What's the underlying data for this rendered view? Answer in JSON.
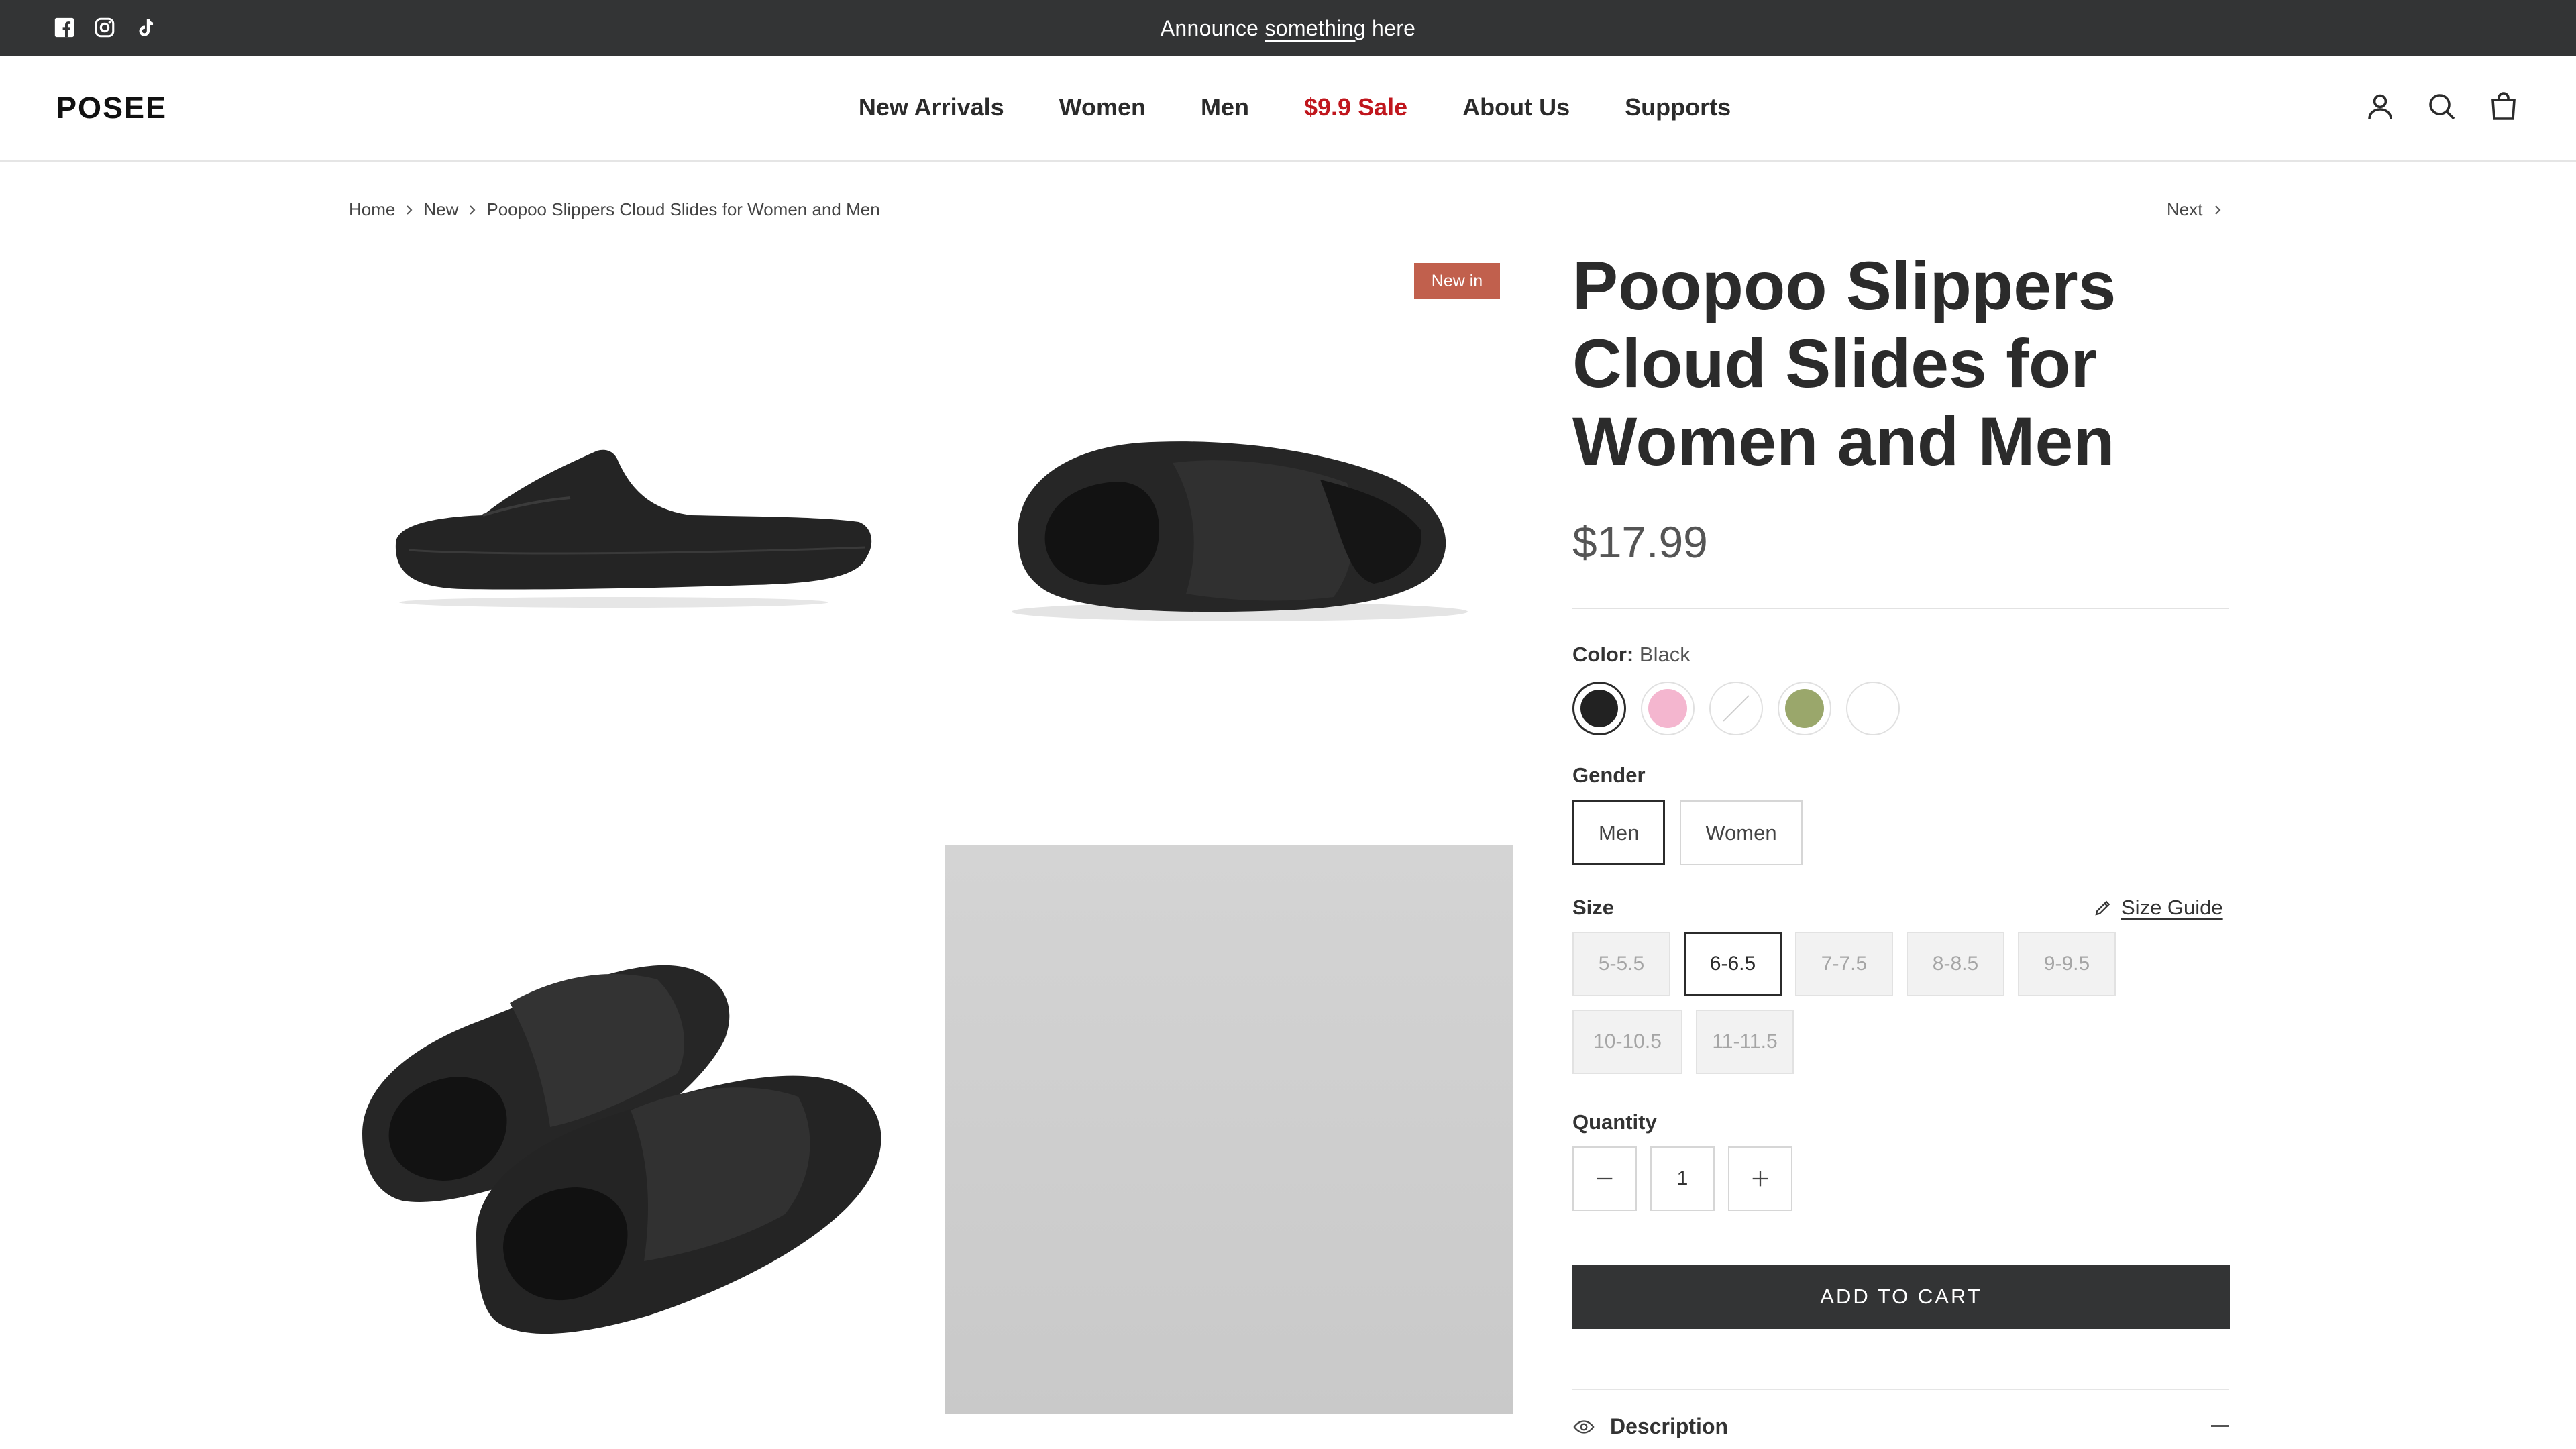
{
  "announcement": {
    "text_before": "Announce ",
    "text_link": "something",
    "text_after": " here",
    "social_icons": [
      "facebook-icon",
      "instagram-icon",
      "tiktok-icon"
    ]
  },
  "header": {
    "logo": "POSEE",
    "nav": [
      "New Arrivals",
      "Women",
      "Men",
      "$9.9 Sale",
      "About Us",
      "Supports"
    ],
    "sale_color": "#c0161d",
    "icons": [
      "account-icon",
      "search-icon",
      "cart-icon"
    ]
  },
  "breadcrumb": {
    "items": [
      "Home",
      "New",
      "Poopoo Slippers Cloud Slides for Women and Men"
    ],
    "next_label": "Next"
  },
  "gallery": {
    "badge": "New in",
    "badge_color": "#c1604d",
    "images": [
      "slide-side-view",
      "slide-angled-view",
      "slide-pair-view",
      "placeholder-gray"
    ]
  },
  "product": {
    "title": "Poopoo Slippers Cloud Slides for Women and Men",
    "price": "$17.99",
    "color_label": "Color:",
    "color_value": "Black",
    "swatches": [
      {
        "name": "Black",
        "hex": "#222222"
      },
      {
        "name": "Pink",
        "hex": "#f4b6cf"
      },
      {
        "name": "Unavailable",
        "hex": "#ffffff"
      },
      {
        "name": "Green",
        "hex": "#9aa76b"
      },
      {
        "name": "White",
        "hex": "#ffffff"
      }
    ],
    "gender_label": "Gender",
    "genders": [
      "Men",
      "Women"
    ],
    "gender_selected": "Men",
    "size_label": "Size",
    "size_guide": "Size Guide",
    "sizes": [
      "5-5.5",
      "6-6.5",
      "7-7.5",
      "8-8.5",
      "9-9.5",
      "10-10.5",
      "11-11.5"
    ],
    "size_selected": "6-6.5",
    "quantity_label": "Quantity",
    "quantity": "1",
    "add_to_cart": "ADD TO CART",
    "description_label": "Description"
  }
}
